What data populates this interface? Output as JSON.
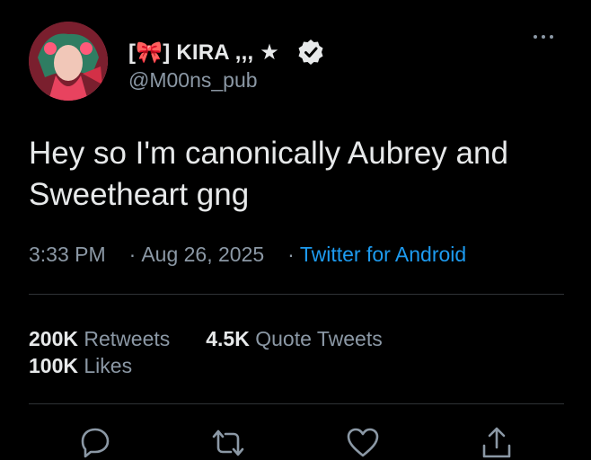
{
  "user": {
    "display_name": "[🎀] KIRA ,,, ★",
    "handle": "@M00ns_pub",
    "verified": true
  },
  "tweet": {
    "text": "Hey so I'm canonically Aubrey and Sweetheart gng",
    "time": "3:33 PM",
    "date": "Aug 26, 2025",
    "source": "Twitter for Android"
  },
  "stats": {
    "retweets_count": "200K",
    "retweets_label": "Retweets",
    "quotes_count": "4.5K",
    "quotes_label": "Quote Tweets",
    "likes_count": "100K",
    "likes_label": "Likes"
  },
  "icons": {
    "more": "more-options-icon",
    "verified": "verified-badge-icon",
    "reply": "reply-icon",
    "retweet": "retweet-icon",
    "like": "heart-icon",
    "share": "share-icon"
  },
  "colors": {
    "background": "#000000",
    "text": "#e7e9ea",
    "muted": "#8b98a5",
    "link": "#1d9bf0",
    "divider": "#2f3336"
  }
}
